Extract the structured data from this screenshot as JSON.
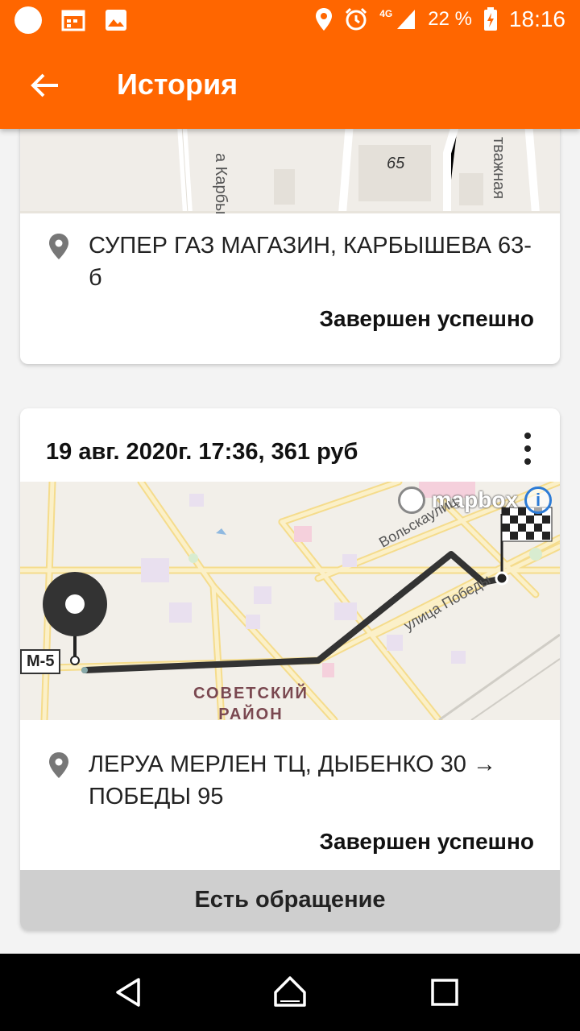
{
  "status_bar": {
    "network": "4G",
    "battery": "22 %",
    "time": "18:16"
  },
  "app_bar": {
    "title": "История"
  },
  "map_labels": {
    "street_top_1": "а Карбы",
    "building_number": "65",
    "street_top_2": "тважная",
    "mapbox": "mapbox",
    "info": "i",
    "highway": "M-5",
    "district_line1": "СОВЕТСКИЙ",
    "district_line2": "РАЙОН",
    "street_volskaya": "Вольскаулиц",
    "street_pobedy": "улица Победы"
  },
  "trips": [
    {
      "address": "СУПЕР ГАЗ МАГАЗИН, КАРБЫШЕВА 63-б",
      "status": "Завершен успешно"
    },
    {
      "header": "19 авг. 2020г. 17:36, 361 руб",
      "address": "ЛЕРУА МЕРЛЕН ТЦ, ДЫБЕНКО 30 → ПОБЕДЫ 95",
      "status": "Завершен успешно",
      "appeal": "Есть обращение"
    }
  ],
  "colors": {
    "accent": "#ff6600",
    "route": "#333333"
  }
}
